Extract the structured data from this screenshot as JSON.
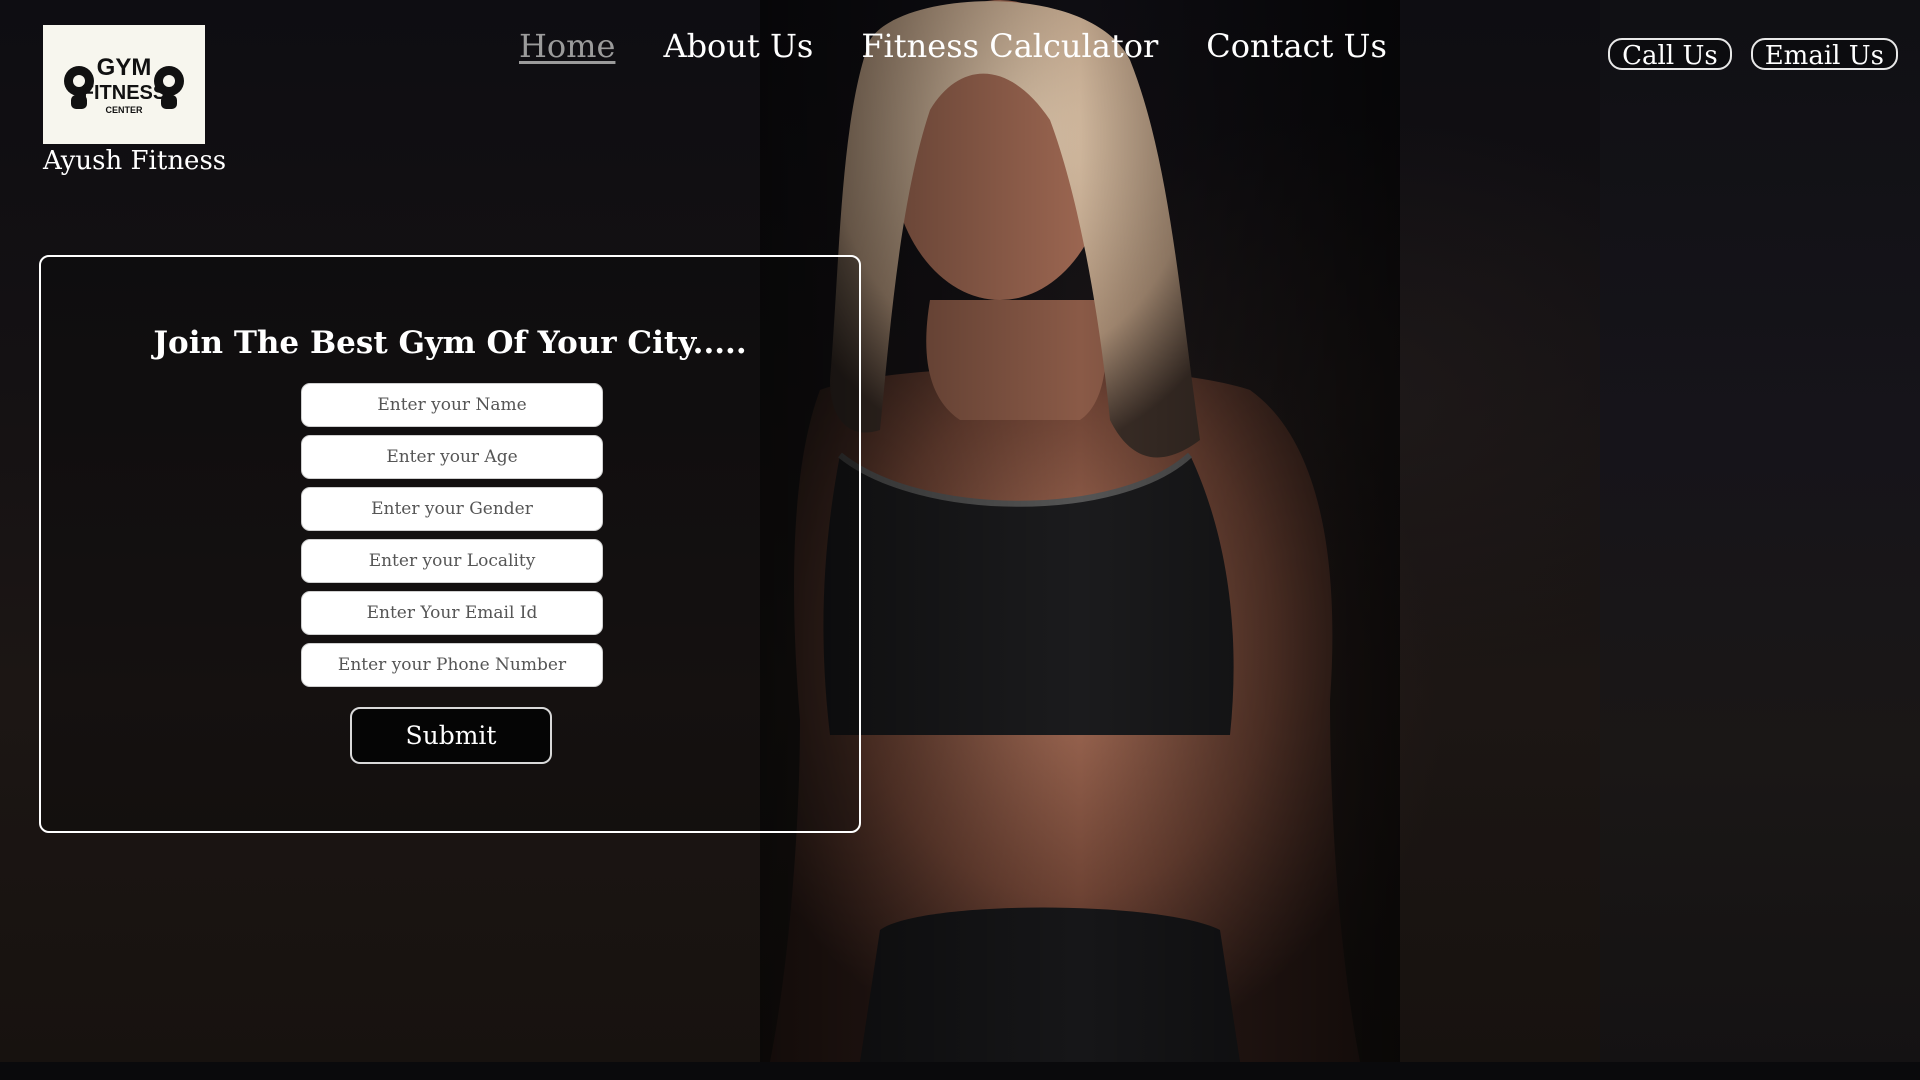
{
  "brand": {
    "logo_text_top": "GYM",
    "logo_text_mid": "FITNESS",
    "logo_text_bottom": "CENTER",
    "name": "Ayush Fitness"
  },
  "nav": {
    "items": [
      {
        "label": "Home",
        "active": true
      },
      {
        "label": "About Us",
        "active": false
      },
      {
        "label": "Fitness Calculator",
        "active": false
      },
      {
        "label": "Contact Us",
        "active": false
      }
    ]
  },
  "actions": {
    "call_label": "Call Us",
    "email_label": "Email Us"
  },
  "form": {
    "title": "Join The Best Gym Of Your City.....",
    "fields": [
      {
        "placeholder": "Enter your Name",
        "value": ""
      },
      {
        "placeholder": "Enter your Age",
        "value": ""
      },
      {
        "placeholder": "Enter your Gender",
        "value": ""
      },
      {
        "placeholder": "Enter your Locality",
        "value": ""
      },
      {
        "placeholder": "Enter Your Email Id",
        "value": ""
      },
      {
        "placeholder": "Enter your Phone Number",
        "value": ""
      }
    ],
    "submit_label": "Submit"
  },
  "colors": {
    "background": "#0c0b0e",
    "text": "#ffffff",
    "nav_active": "#9b9b9b",
    "logo_bg": "#f7f6ee",
    "submit_bg": "#050505"
  },
  "icons": {
    "logo": "dumbbell-logo-icon"
  }
}
